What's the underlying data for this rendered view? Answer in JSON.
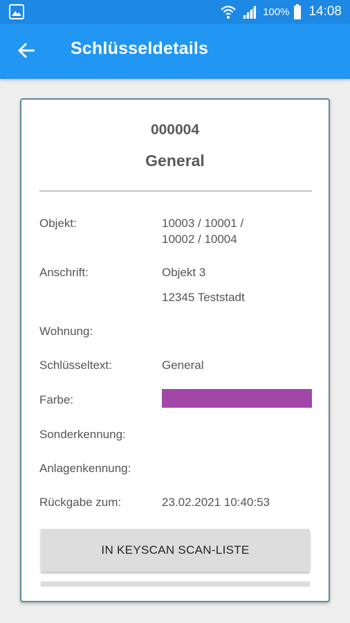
{
  "status_bar": {
    "battery_percent": "100%",
    "time": "14:08",
    "icons": [
      "gallery-icon",
      "wifi-icon",
      "signal-icon",
      "battery-icon"
    ]
  },
  "app_bar": {
    "title": "Schlüsseldetails",
    "back_icon": "arrow-back-icon"
  },
  "key": {
    "number": "000004",
    "name": "General",
    "fields": {
      "objekt_label": "Objekt:",
      "objekt_line1": "10003 / 10001 /",
      "objekt_line2": "10002 / 10004",
      "anschrift_label": "Anschrift:",
      "anschrift_line1": "Objekt 3",
      "anschrift_line2": "12345 Teststadt",
      "wohnung_label": "Wohnung:",
      "schluesseltext_label": "Schlüsseltext:",
      "schluesseltext_value": "General",
      "farbe_label": "Farbe:",
      "farbe_color": "#a147a8",
      "sonderkennung_label": "Sonderkennung:",
      "anlagenkennung_label": "Anlagenkennung:",
      "rueckgabe_label": "Rückgabe zum:",
      "rueckgabe_value": "23.02.2021 10:40:53"
    }
  },
  "actions": {
    "scan_list_button": "IN KEYSCAN SCAN-LISTE"
  },
  "colors": {
    "status_bar": "#1e88e5",
    "app_bar": "#2196f3",
    "card_border": "#5e8a9a",
    "background": "#eeeeee"
  }
}
